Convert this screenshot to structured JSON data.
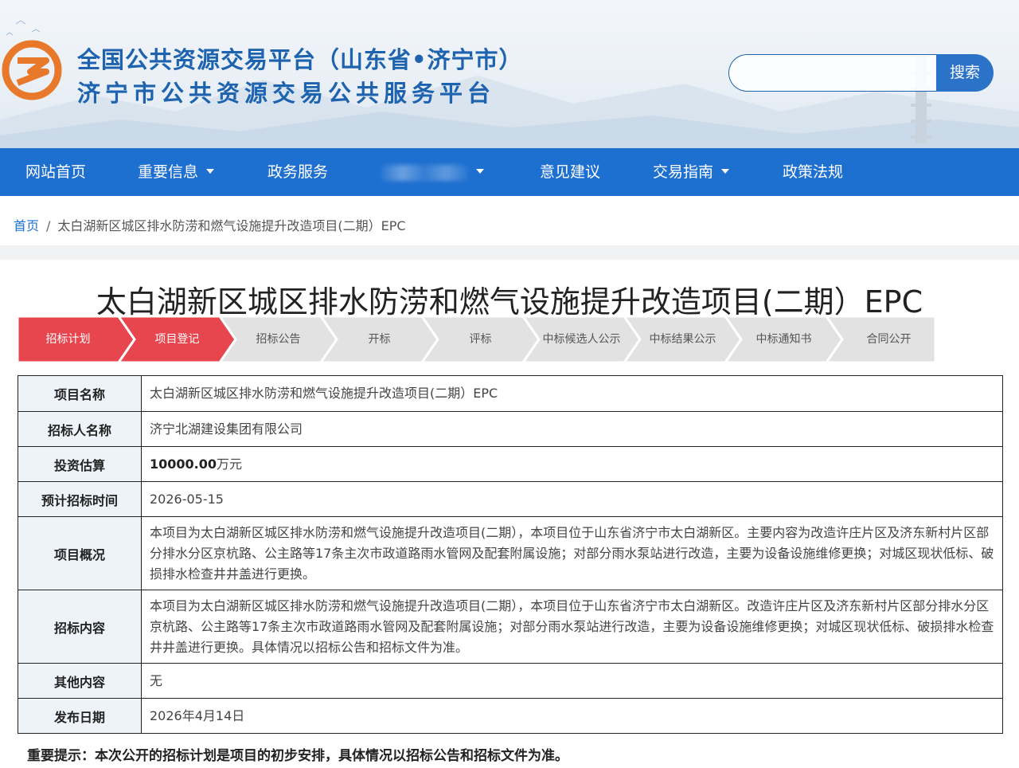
{
  "header": {
    "title_line1": "全国公共资源交易平台（山东省•济宁市）",
    "title_line2": "济宁市公共资源交易公共服务平台",
    "search": {
      "placeholder": "",
      "button_label": "搜索"
    }
  },
  "nav": {
    "items": [
      {
        "label": "网站首页",
        "dropdown": false
      },
      {
        "label": "重要信息",
        "dropdown": true
      },
      {
        "label": "政务服务",
        "dropdown": false
      },
      {
        "label": "",
        "dropdown": true
      },
      {
        "label": "意见建议",
        "dropdown": false
      },
      {
        "label": "交易指南",
        "dropdown": true
      },
      {
        "label": "政策法规",
        "dropdown": false
      }
    ]
  },
  "breadcrumb": {
    "home": "首页",
    "separator": "/",
    "current": "太白湖新区城区排水防涝和燃气设施提升改造项目(二期）EPC"
  },
  "page_title": "太白湖新区城区排水防涝和燃气设施提升改造项目(二期）EPC",
  "steps": {
    "active_color": "#e8464e",
    "inactive_color": "#e2e2e2",
    "items": [
      {
        "label": "招标计划",
        "active": true
      },
      {
        "label": "项目登记",
        "active": true
      },
      {
        "label": "招标公告",
        "active": false
      },
      {
        "label": "开标",
        "active": false
      },
      {
        "label": "评标",
        "active": false
      },
      {
        "label": "中标候选人公示",
        "active": false
      },
      {
        "label": "中标结果公示",
        "active": false
      },
      {
        "label": "中标通知书",
        "active": false
      },
      {
        "label": "合同公开",
        "active": false
      }
    ]
  },
  "table": {
    "rows": [
      {
        "key": "项目名称",
        "value": "太白湖新区城区排水防涝和燃气设施提升改造项目(二期）EPC"
      },
      {
        "key": "招标人名称",
        "value": "济宁北湖建设集团有限公司"
      },
      {
        "key": "投资估算",
        "value_bold": "10000.00",
        "value_unit": "万元"
      },
      {
        "key": "预计招标时间",
        "value": "2026-05-15"
      },
      {
        "key": "项目概况",
        "value": "本项目为太白湖新区城区排水防涝和燃气设施提升改造项目(二期），本项目位于山东省济宁市太白湖新区。主要内容为改造许庄片区及济东新村片区部分排水分区京杭路、公主路等17条主次市政道路雨水管网及配套附属设施；对部分雨水泵站进行改造，主要为设备设施维修更换；对城区现状低标、破损排水检查井井盖进行更换。"
      },
      {
        "key": "招标内容",
        "value": "本项目为太白湖新区城区排水防涝和燃气设施提升改造项目(二期），本项目位于山东省济宁市太白湖新区。改造许庄片区及济东新村片区部分排水分区京杭路、公主路等17条主次市政道路雨水管网及配套附属设施；对部分雨水泵站进行改造，主要为设备设施维修更换；对城区现状低标、破损排水检查井井盖进行更换。具体情况以招标公告和招标文件为准。"
      },
      {
        "key": "其他内容",
        "value": "无"
      },
      {
        "key": "发布日期",
        "value": "2026年4月14日"
      }
    ]
  },
  "tip": "重要提示：本次公开的招标计划是项目的初步安排，具体情况以招标公告和招标文件为准。",
  "colors": {
    "brand_blue": "#1d6fd0",
    "title_blue": "#1e63b0",
    "logo_orange": "#e8782a"
  }
}
